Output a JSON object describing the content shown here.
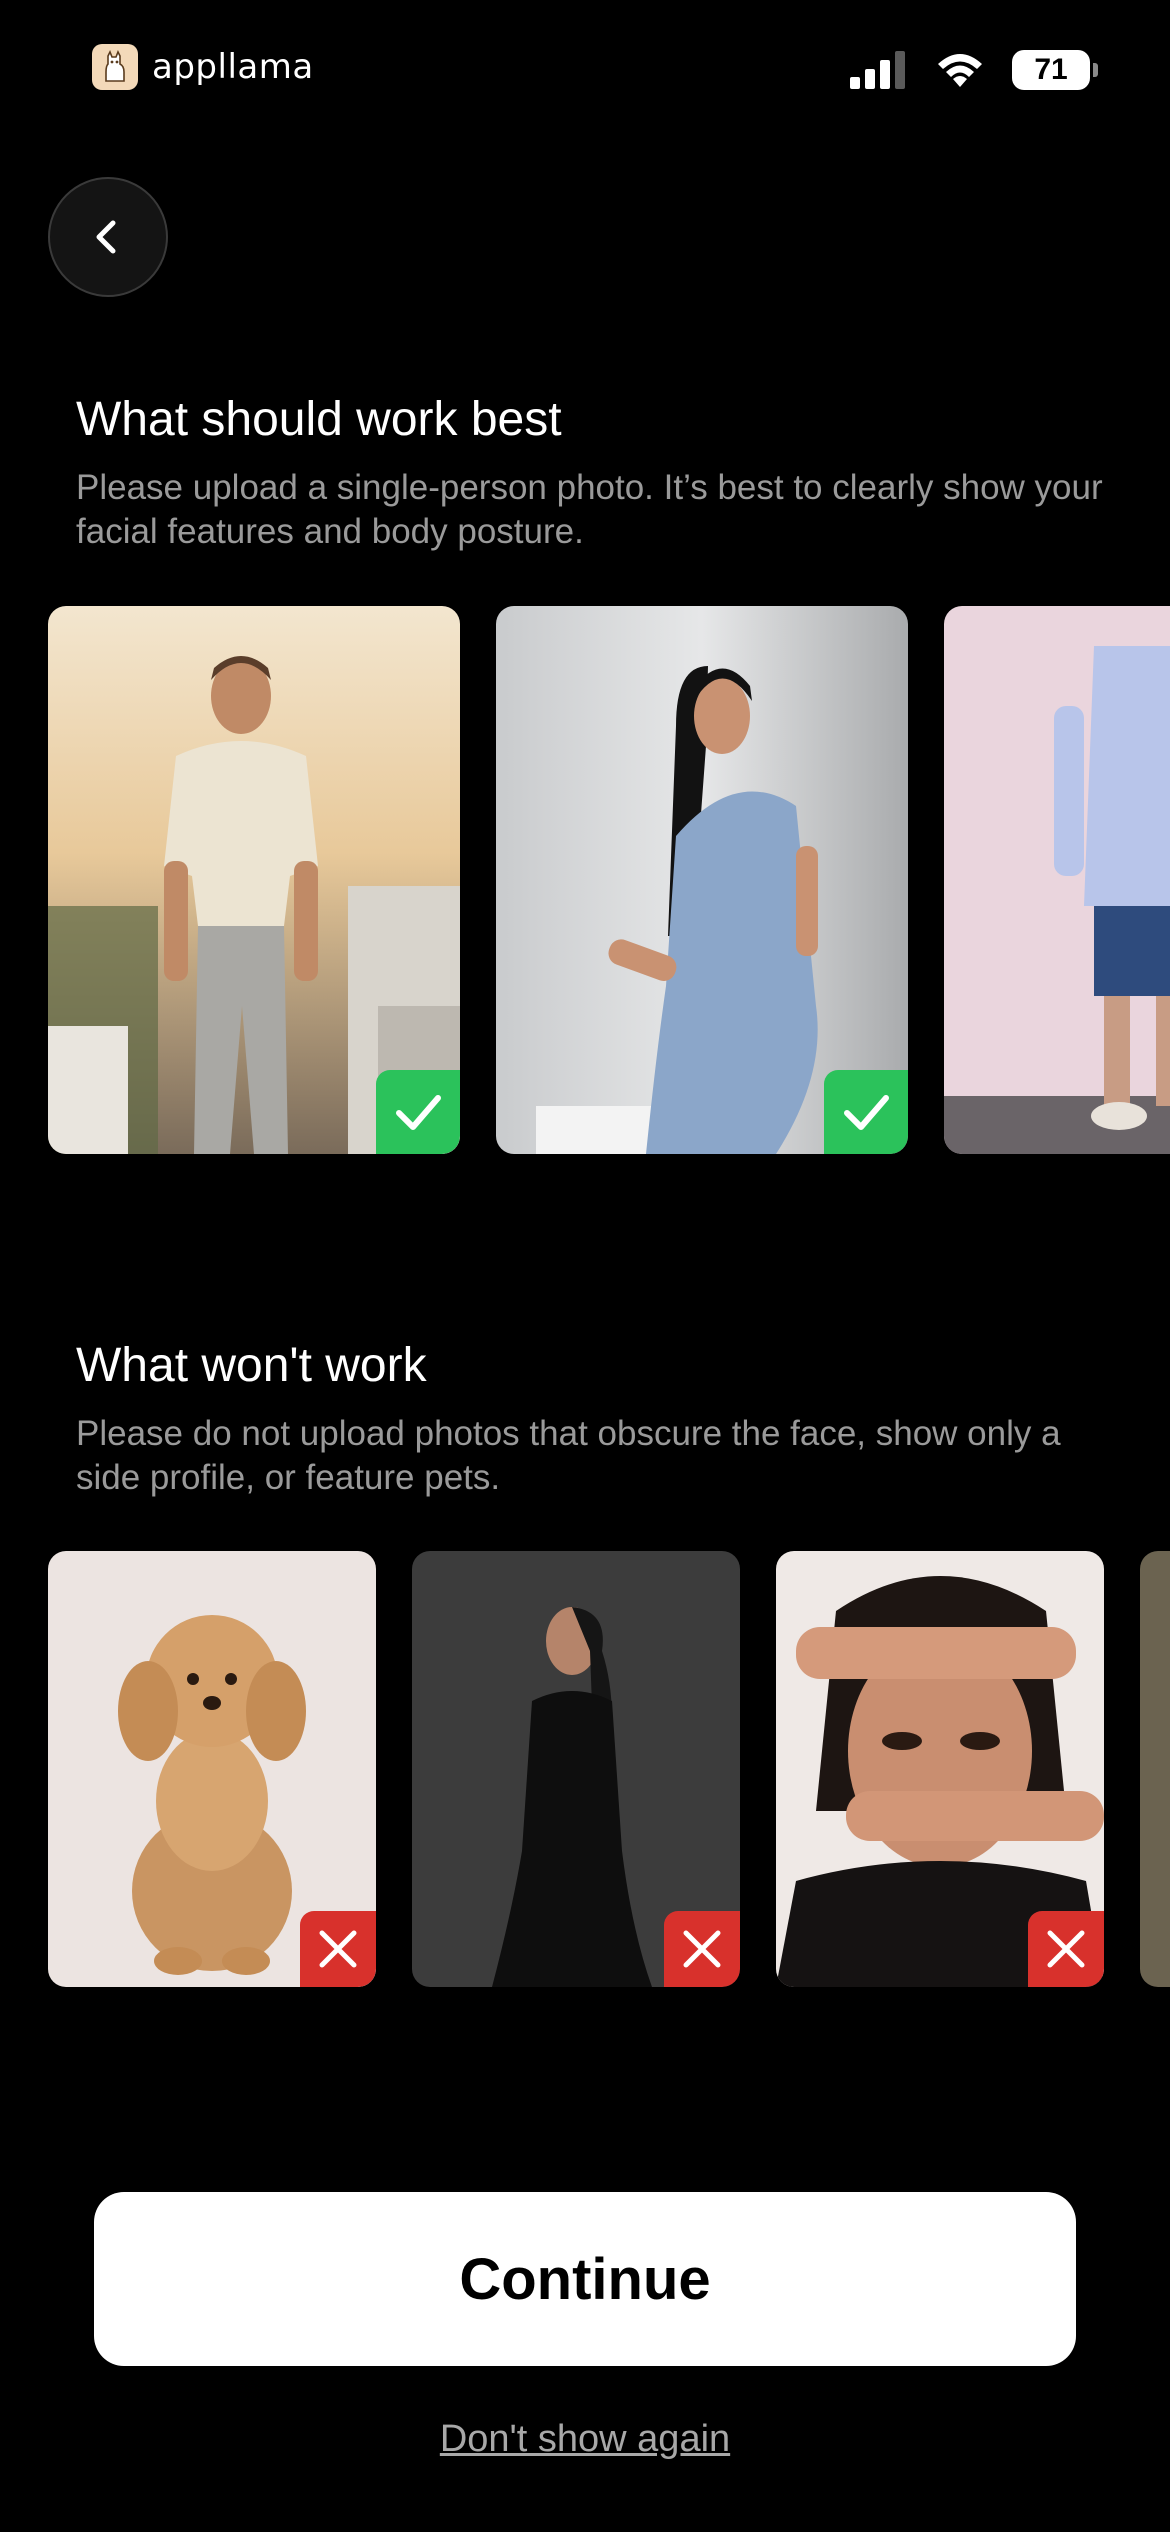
{
  "status_bar": {
    "brand": "appllama",
    "battery": "71"
  },
  "good_section": {
    "title": "What should work best",
    "description": "Please upload a single-person photo. It’s best to clearly show your facial features and body posture."
  },
  "bad_section": {
    "title": "What won't work",
    "description": "Please do not upload photos that obscure the face, show only a side profile, or feature pets."
  },
  "actions": {
    "continue_label": "Continue",
    "dont_show_label": "Don't show again"
  },
  "colors": {
    "background": "#000000",
    "good_badge": "#2bc25b",
    "bad_badge": "#d8312c"
  }
}
